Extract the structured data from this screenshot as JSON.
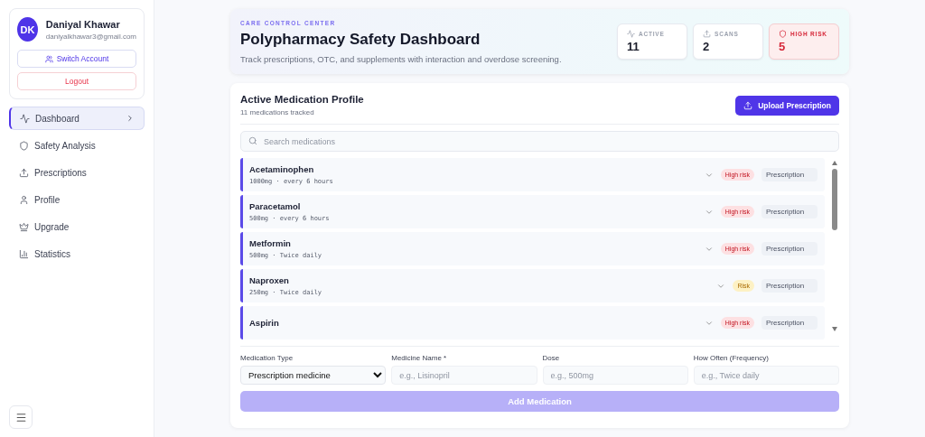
{
  "user": {
    "initials": "DK",
    "name": "Daniyal Khawar",
    "email": "daniyalkhawar3@gmail.com",
    "buttons": [
      {
        "kind": "switch",
        "label": "Switch Account"
      },
      {
        "kind": "logout",
        "label": "Logout"
      }
    ]
  },
  "nav": [
    {
      "kind": "activity",
      "label": "Dashboard",
      "selected": true
    },
    {
      "kind": "shield",
      "label": "Safety Analysis",
      "selected": false
    },
    {
      "kind": "upload",
      "label": "Prescriptions",
      "selected": false
    },
    {
      "kind": "user",
      "label": "Profile",
      "selected": false
    },
    {
      "kind": "crown",
      "label": "Upgrade",
      "selected": false
    },
    {
      "kind": "chart",
      "label": "Statistics",
      "selected": false
    }
  ],
  "header": {
    "eyebrow": "CARE CONTROL CENTER",
    "title": "Polypharmacy Safety Dashboard",
    "subtitle": "Track prescriptions, OTC, and supplements with interaction and overdose screening.",
    "stats": [
      {
        "kind": "activity",
        "label": "ACTIVE",
        "value": "11",
        "alert": false
      },
      {
        "kind": "upload",
        "label": "SCANS",
        "value": "2",
        "alert": false
      },
      {
        "kind": "shield",
        "label": "HIGH RISK",
        "value": "5",
        "alert": true
      }
    ]
  },
  "profile": {
    "title": "Active Medication Profile",
    "count": "11 medications tracked",
    "upload_button": "Upload Prescription",
    "search": {
      "placeholder": "Search medications"
    },
    "medications": [
      {
        "name": "Acetaminophen",
        "detail": "1000mg · every 6 hours",
        "kind": "high",
        "badge": "High risk",
        "type": "Prescription"
      },
      {
        "name": "Paracetamol",
        "detail": "500mg · every 6 hours",
        "kind": "high",
        "badge": "High risk",
        "type": "Prescription"
      },
      {
        "name": "Metformin",
        "detail": "500mg · Twice daily",
        "kind": "high",
        "badge": "High risk",
        "type": "Prescription"
      },
      {
        "name": "Naproxen",
        "detail": "250mg · Twice daily",
        "kind": "medium",
        "badge": "Risk",
        "type": "Prescription"
      },
      {
        "name": "Aspirin",
        "kind": "high",
        "badge": "High risk",
        "type": "Prescription"
      }
    ],
    "form": {
      "fields": [
        {
          "kind": "select",
          "label": "Medication Type",
          "value": "Prescription medicine"
        },
        {
          "kind": "input",
          "label": "Medicine Name *",
          "placeholder": "e.g., Lisinopril"
        },
        {
          "kind": "input",
          "label": "Dose",
          "placeholder": "e.g., 500mg"
        },
        {
          "kind": "input",
          "label": "How Often (Frequency)",
          "placeholder": "e.g., Twice daily"
        }
      ],
      "submit": {
        "label": "Add Medication",
        "disabled": true
      }
    }
  }
}
